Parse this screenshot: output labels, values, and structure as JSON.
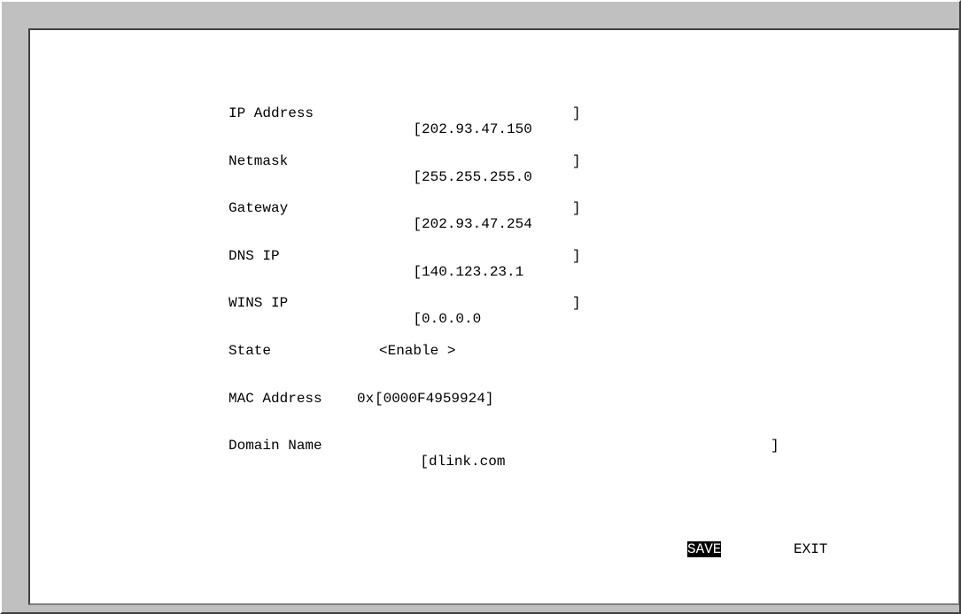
{
  "fields": [
    {
      "label": "IP Address",
      "value": "202.93.47.150",
      "box_open": "[",
      "box_close": "]"
    },
    {
      "label": "Netmask",
      "value": "255.255.255.0",
      "box_open": "[",
      "box_close": "]"
    },
    {
      "label": "Gateway",
      "value": "202.93.47.254",
      "box_open": "[",
      "box_close": "]"
    },
    {
      "label": "DNS IP",
      "value": "140.123.23.1",
      "box_open": "[",
      "box_close": "]"
    },
    {
      "label": "WINS IP",
      "value": "0.0.0.0",
      "box_open": "[",
      "box_close": "]"
    }
  ],
  "state": {
    "label": "State",
    "value": "<Enable >"
  },
  "mac": {
    "label": "MAC Address",
    "prefix": "0x",
    "value": "[0000F4959924]"
  },
  "domain": {
    "label": "Domain Name",
    "value": "dlink.com",
    "box_open": "[",
    "box_close": "]"
  },
  "buttons": {
    "save": "SAVE",
    "exit": "EXIT"
  },
  "colors": {
    "frame": "#c0c0c0",
    "panel": "#ffffff",
    "text": "#000000",
    "highlight_bg": "#000000",
    "highlight_fg": "#ffffff"
  }
}
